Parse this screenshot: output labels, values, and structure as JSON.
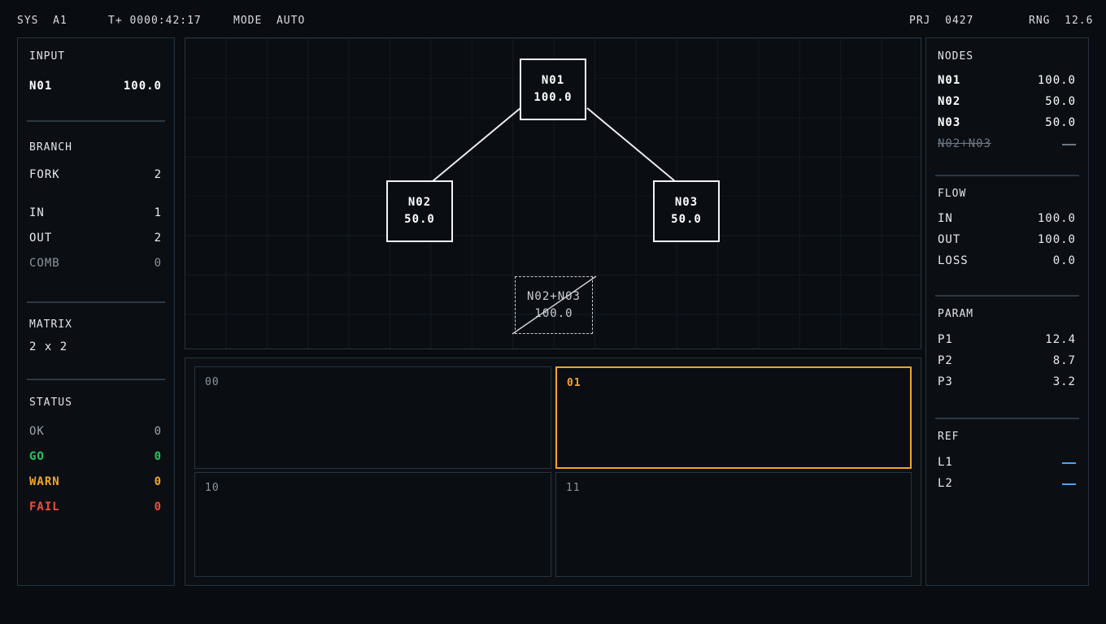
{
  "topbar": {
    "sys": "SYS  A1",
    "time": "T+ 0000:42:17",
    "mode": "MODE  AUTO",
    "prj": "PRJ  0427",
    "rng": "RNG  12.6"
  },
  "left": {
    "input": {
      "title": "INPUT",
      "label": "N01",
      "value": "100.0"
    },
    "branch": {
      "title": "BRANCH",
      "rows": [
        {
          "label": "FORK",
          "value": "2"
        },
        {
          "label": "IN",
          "value": "1"
        },
        {
          "label": "OUT",
          "value": "2"
        },
        {
          "label": "COMB",
          "value": "0"
        }
      ]
    },
    "matrix": {
      "title": "MATRIX",
      "value": "2 x 2"
    },
    "status": {
      "title": "STATUS",
      "rows": [
        {
          "label": "OK",
          "value": "0"
        },
        {
          "label": "GO",
          "value": "0"
        },
        {
          "label": "WARN",
          "value": "0"
        },
        {
          "label": "FAIL",
          "value": "0"
        }
      ]
    }
  },
  "graph": {
    "nodes": [
      {
        "name": "N01",
        "value": "100.0"
      },
      {
        "name": "N02",
        "value": "50.0"
      },
      {
        "name": "N03",
        "value": "50.0"
      }
    ],
    "combined": {
      "name": "N02+N03",
      "value": "100.0"
    }
  },
  "matrix_cells": [
    {
      "label": "00",
      "active": false
    },
    {
      "label": "01",
      "active": true
    },
    {
      "label": "10",
      "active": false
    },
    {
      "label": "11",
      "active": false
    }
  ],
  "right": {
    "nodes": {
      "title": "NODES",
      "rows": [
        {
          "label": "N01",
          "value": "100.0"
        },
        {
          "label": "N02",
          "value": "50.0"
        },
        {
          "label": "N03",
          "value": "50.0"
        },
        {
          "label": "N02+N03",
          "value": ""
        }
      ]
    },
    "flow": {
      "title": "FLOW",
      "rows": [
        {
          "label": "IN",
          "value": "100.0"
        },
        {
          "label": "OUT",
          "value": "100.0"
        },
        {
          "label": "LOSS",
          "value": "0.0"
        }
      ]
    },
    "param": {
      "title": "PARAM",
      "rows": [
        {
          "label": "P1",
          "value": "12.4"
        },
        {
          "label": "P2",
          "value": "8.7"
        },
        {
          "label": "P3",
          "value": "3.2"
        }
      ]
    },
    "ref": {
      "title": "REF",
      "rows": [
        {
          "label": "L1"
        },
        {
          "label": "L2"
        }
      ]
    }
  },
  "colors": {
    "accent": "#f5a524",
    "go": "#22c55e",
    "warn": "#f5a524",
    "fail": "#f04d3a",
    "ref": "#4aa3ff"
  }
}
